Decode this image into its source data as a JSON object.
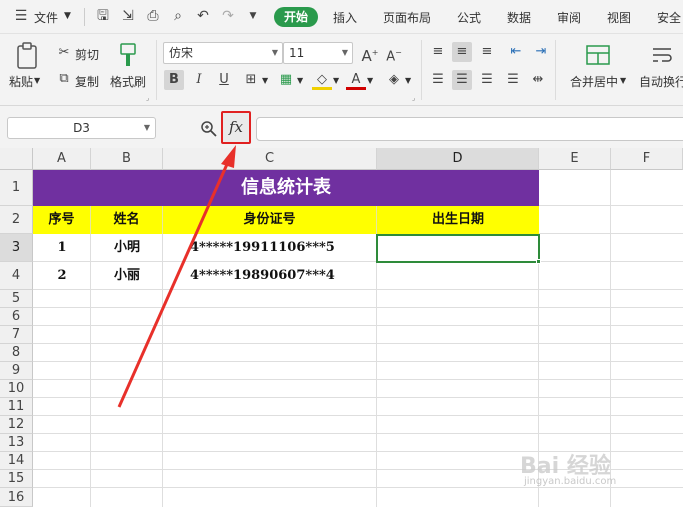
{
  "menu": {
    "file_label": "文件",
    "tabs": [
      "开始",
      "插入",
      "页面布局",
      "公式",
      "数据",
      "审阅",
      "视图",
      "安全"
    ]
  },
  "ribbon": {
    "paste": "粘贴",
    "cut": "剪切",
    "copy": "复制",
    "format_painter": "格式刷",
    "font_name": "仿宋",
    "font_size": "11",
    "merge_center": "合并居中",
    "wrap_text": "自动换行"
  },
  "formula_bar": {
    "name_box": "D3",
    "fx_label": "fx",
    "formula": ""
  },
  "sheet": {
    "columns": [
      "A",
      "B",
      "C",
      "D",
      "E",
      "F"
    ],
    "rows": [
      "1",
      "2",
      "3",
      "4",
      "5",
      "6",
      "7",
      "8",
      "9",
      "10",
      "11",
      "12",
      "13",
      "14",
      "15",
      "16"
    ],
    "selected_column": "D",
    "selected_row": "3",
    "title": "信息统计表",
    "headers": [
      "序号",
      "姓名",
      "身份证号",
      "出生日期"
    ],
    "data": [
      [
        "1",
        "小明",
        "4*****19911106***5",
        ""
      ],
      [
        "2",
        "小丽",
        "4*****19890607***4",
        ""
      ]
    ]
  },
  "watermark": {
    "text": "Bai 经验",
    "sub": "jingyan.baidu.com"
  },
  "colors": {
    "title_bg": "#7030a0",
    "header_bg": "#ffff00",
    "accent_green": "#2a9a4c",
    "highlight_red": "#e02020"
  }
}
